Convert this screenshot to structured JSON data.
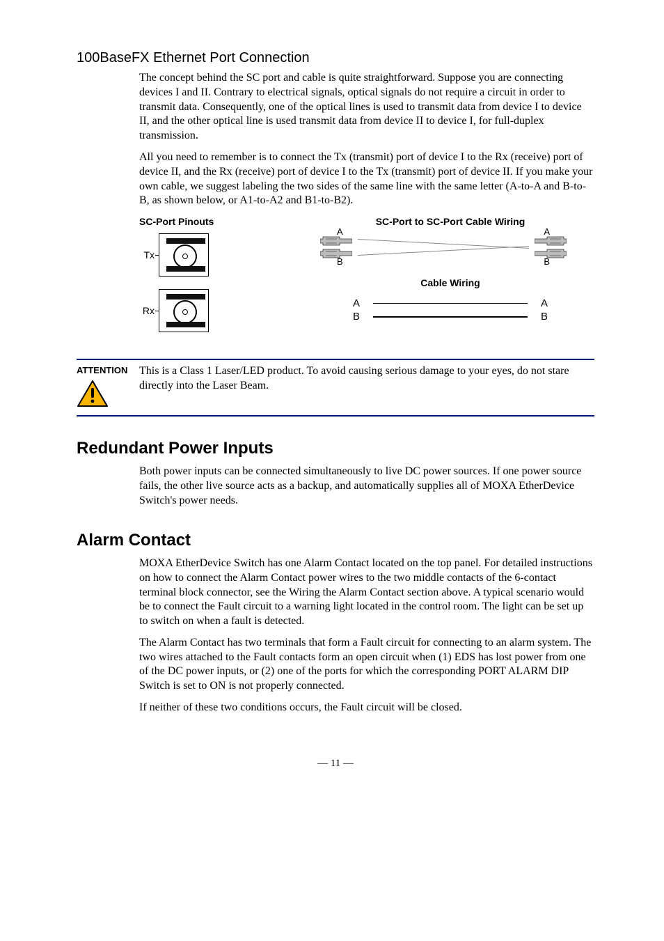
{
  "h_100basefx": "100BaseFX Ethernet Port Connection",
  "p_fx_1": "The concept behind the SC port and cable is quite straightforward. Suppose you are connecting devices I and II. Contrary to electrical signals, optical signals do not require a circuit in order to transmit data. Consequently, one of the optical lines is used to transmit data from device I to device II, and the other optical line is used transmit data from device II to device I, for full-duplex transmission.",
  "p_fx_2": "All you need to remember is to connect the Tx (transmit) port of device I to the Rx (receive) port of device II, and the Rx (receive) port of device I to the Tx (transmit) port of device II. If you make your own cable, we suggest labeling the two sides of the same line with the same letter (A-to-A and B-to-B, as shown below, or A1-to-A2 and B1-to-B2).",
  "fig": {
    "pinouts_title": "SC-Port Pinouts",
    "wiring_title": "SC-Port to SC-Port Cable Wiring",
    "tx": "Tx",
    "rx": "Rx",
    "a": "A",
    "b": "B",
    "cable_wiring": "Cable Wiring"
  },
  "attention": {
    "label": "ATTENTION",
    "text": "This is a Class 1 Laser/LED product. To avoid causing serious damage to your eyes, do not stare directly into the Laser Beam."
  },
  "h_redundant": "Redundant Power Inputs",
  "p_redundant": "Both power inputs can be connected simultaneously to live DC power sources. If one power source fails, the other live source acts as a backup, and automatically supplies all of MOXA EtherDevice Switch's power needs.",
  "h_alarm": "Alarm Contact",
  "p_alarm_1": "MOXA EtherDevice Switch has one Alarm Contact located on the top panel. For detailed instructions on how to connect the Alarm Contact power wires to the two middle contacts of the 6-contact terminal block connector, see the Wiring the Alarm Contact section above. A typical scenario would be to connect the Fault circuit to a warning light located in the control room. The light can be set up to switch on when a fault is detected.",
  "p_alarm_2": "The Alarm Contact has two terminals that form a Fault circuit for connecting to an alarm system. The two wires attached to the Fault contacts form an open circuit when (1) EDS has lost power from one of the DC power inputs, or (2) one of the ports for which the corresponding PORT ALARM DIP Switch is set to ON is not properly connected.",
  "p_alarm_3": "If neither of these two conditions occurs, the Fault circuit will be closed.",
  "pagenum": "— 11 —"
}
